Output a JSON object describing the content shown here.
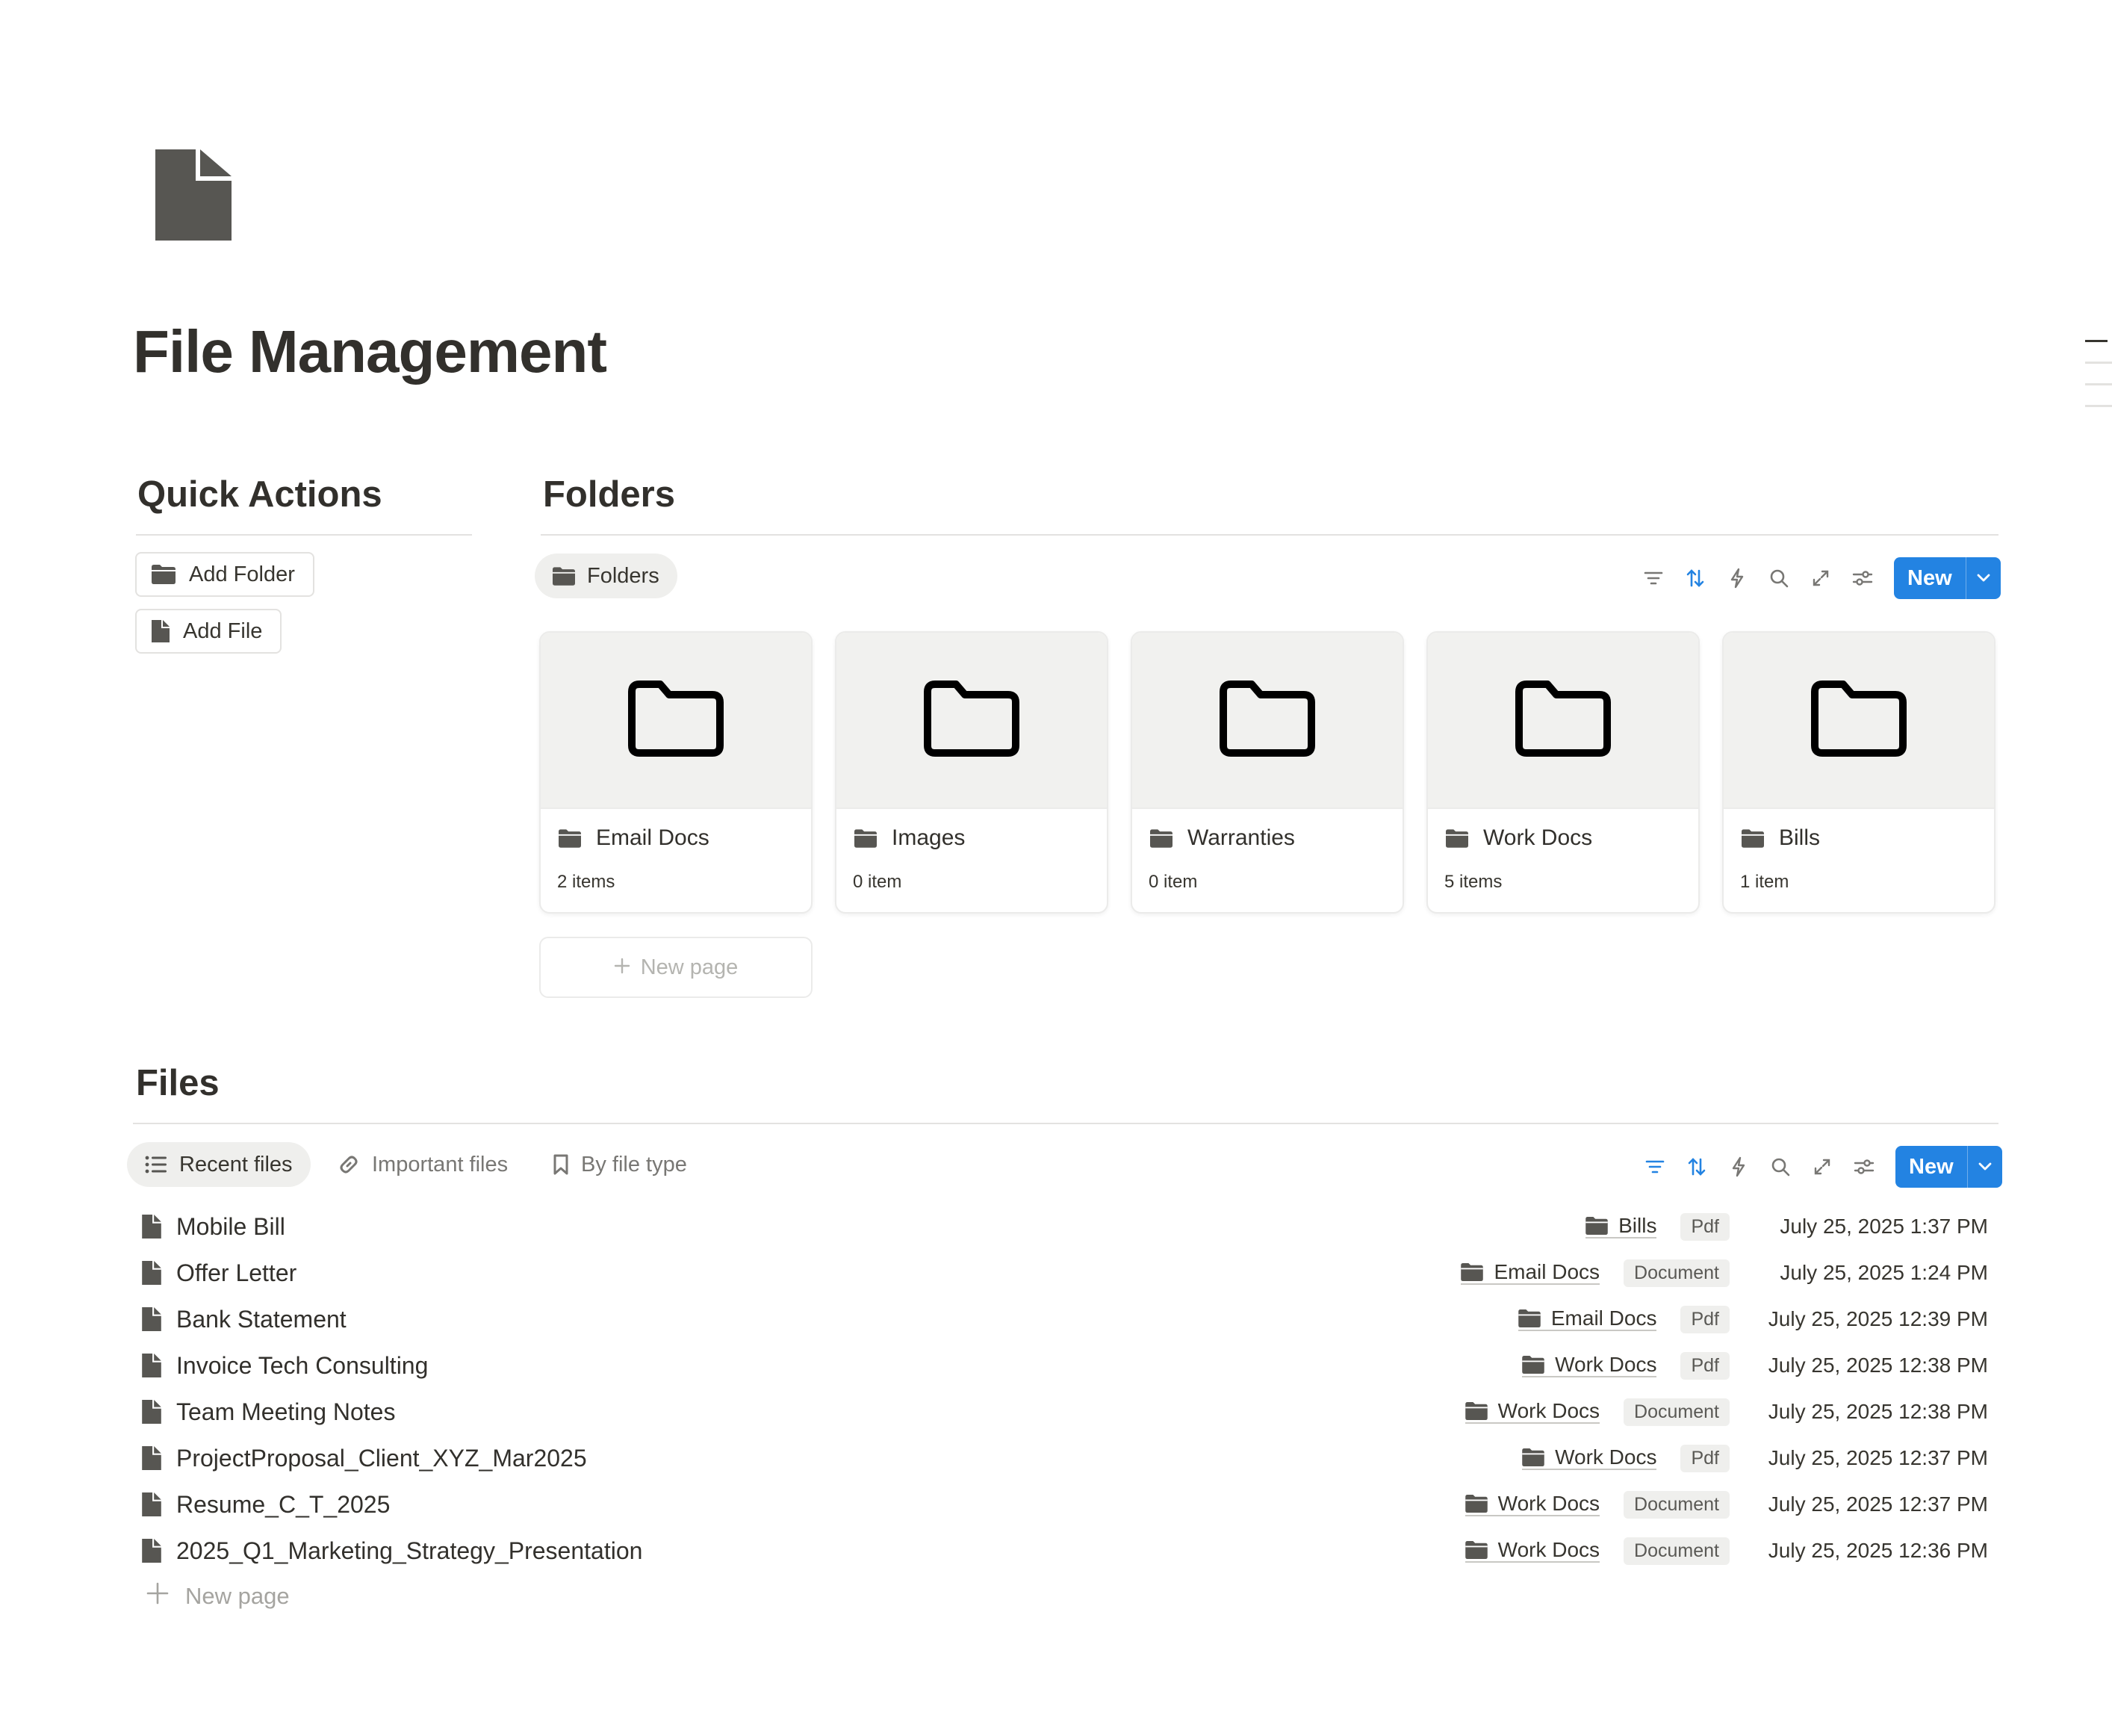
{
  "page": {
    "title": "File Management",
    "icon": "document-icon"
  },
  "quick_actions": {
    "heading": "Quick Actions",
    "buttons": [
      {
        "label": "Add Folder",
        "icon": "folder-icon"
      },
      {
        "label": "Add File",
        "icon": "document-icon"
      }
    ]
  },
  "folders": {
    "heading": "Folders",
    "view_tab": "Folders",
    "toolbar": {
      "icons": [
        "filter-icon",
        "sort-icon",
        "automation-icon",
        "search-icon",
        "expand-icon",
        "settings-icon"
      ],
      "new_label": "New"
    },
    "cards": [
      {
        "name": "Email Docs",
        "count": "2 items"
      },
      {
        "name": "Images",
        "count": "0 item"
      },
      {
        "name": "Warranties",
        "count": "0 item"
      },
      {
        "name": "Work Docs",
        "count": "5 items"
      },
      {
        "name": "Bills",
        "count": "1 item"
      }
    ],
    "new_page_label": "New page"
  },
  "files": {
    "heading": "Files",
    "tabs": [
      {
        "label": "Recent files",
        "icon": "list-icon",
        "active": true
      },
      {
        "label": "Important files",
        "icon": "link-icon",
        "active": false
      },
      {
        "label": "By file type",
        "icon": "bookmark-icon",
        "active": false
      }
    ],
    "toolbar": {
      "new_label": "New"
    },
    "rows": [
      {
        "name": "Mobile Bill",
        "folder": "Bills",
        "type": "Pdf",
        "date": "July 25, 2025 1:37 PM"
      },
      {
        "name": "Offer Letter",
        "folder": "Email Docs",
        "type": "Document",
        "date": "July 25, 2025 1:24 PM"
      },
      {
        "name": "Bank Statement",
        "folder": "Email Docs",
        "type": "Pdf",
        "date": "July 25, 2025 12:39 PM"
      },
      {
        "name": "Invoice Tech Consulting",
        "folder": "Work Docs",
        "type": "Pdf",
        "date": "July 25, 2025 12:38 PM"
      },
      {
        "name": "Team Meeting Notes",
        "folder": "Work Docs",
        "type": "Document",
        "date": "July 25, 2025 12:38 PM"
      },
      {
        "name": "ProjectProposal_Client_XYZ_Mar2025",
        "folder": "Work Docs",
        "type": "Pdf",
        "date": "July 25, 2025 12:37 PM"
      },
      {
        "name": "Resume_C_T_2025",
        "folder": "Work Docs",
        "type": "Document",
        "date": "July 25, 2025 12:37 PM"
      },
      {
        "name": "2025_Q1_Marketing_Strategy_Presentation",
        "folder": "Work Docs",
        "type": "Document",
        "date": "July 25, 2025 12:36 PM"
      }
    ],
    "new_page_label": "New page"
  },
  "colors": {
    "accent": "#2383e2",
    "text": "#37352f",
    "muted": "#787774",
    "border": "#e3e2e0",
    "icon": "#575652"
  }
}
